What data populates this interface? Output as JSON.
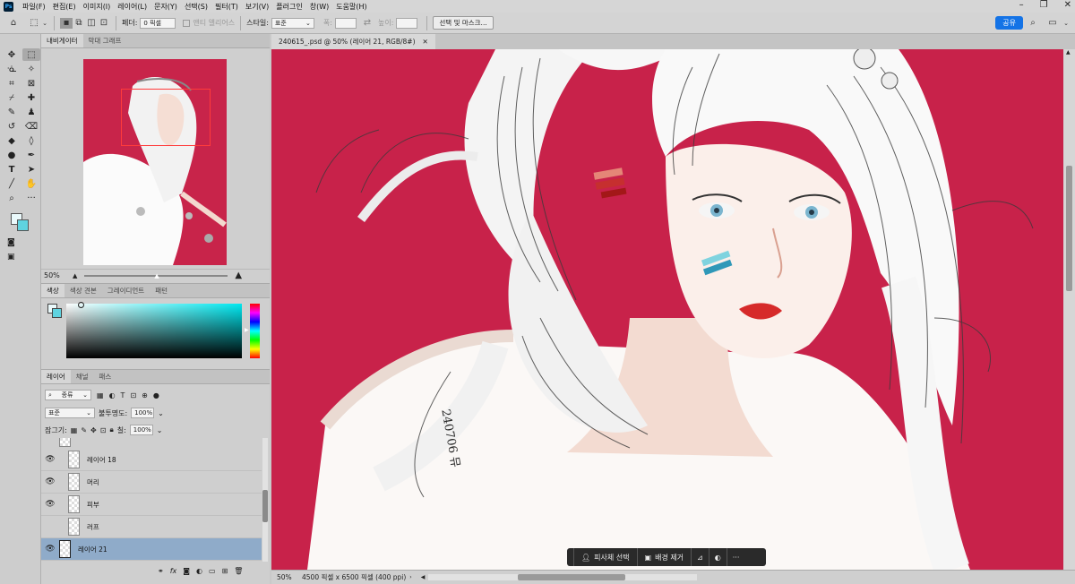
{
  "app": {
    "logo_text": "Ps"
  },
  "menu": [
    "파일(F)",
    "편집(E)",
    "이미지(I)",
    "레이어(L)",
    "문자(Y)",
    "선택(S)",
    "필터(T)",
    "보기(V)",
    "플러그인",
    "창(W)",
    "도움말(H)"
  ],
  "options_bar": {
    "feather_label": "페더:",
    "feather_value": "0 픽셀",
    "antialias_label": "앤티 앨리어스",
    "style_label": "스타일:",
    "style_value": "표준",
    "width_label": "폭:",
    "height_label": "높이:",
    "select_mask_label": "선택 및 마스크...",
    "share_label": "공유"
  },
  "document": {
    "tab_title": "240615_.psd @ 50% (레이어 21, RGB/8#)",
    "close_icon": "close-icon"
  },
  "navigator": {
    "tabs": [
      "내비게이터",
      "막대 그래프"
    ],
    "zoom_label": "50%",
    "zoom_level": 0.5
  },
  "color_panel": {
    "tabs": [
      "색상",
      "색상 견본",
      "그레이디언트",
      "패턴"
    ],
    "fg_color": "#eaf9fb",
    "bg_color": "#5fd3e0",
    "hue_color": "#00e8f0"
  },
  "layers_panel": {
    "tabs": [
      "레이어",
      "채널",
      "패스"
    ],
    "filter_label": "종류",
    "blend_mode": "표준",
    "opacity_label": "불투명도:",
    "opacity_value": "100%",
    "lock_label": "잠그기:",
    "fill_label": "칠:",
    "fill_value": "100%",
    "layers": [
      {
        "name": "레이어 18",
        "visible": true,
        "selected": false
      },
      {
        "name": "머리",
        "visible": true,
        "selected": false
      },
      {
        "name": "피부",
        "visible": true,
        "selected": false
      },
      {
        "name": "러프",
        "visible": false,
        "selected": false
      },
      {
        "name": "레이어 21",
        "visible": true,
        "selected": true
      }
    ]
  },
  "status_bar": {
    "zoom": "50%",
    "doc_info": "4500 픽셀 x 6500 픽셀 (400 ppi)"
  },
  "contextual_bar": {
    "select_subject": "피사체 선택",
    "remove_bg": "배경 제거"
  },
  "canvas": {
    "background": "#c8224a",
    "signature_text": "240706 뮤"
  }
}
